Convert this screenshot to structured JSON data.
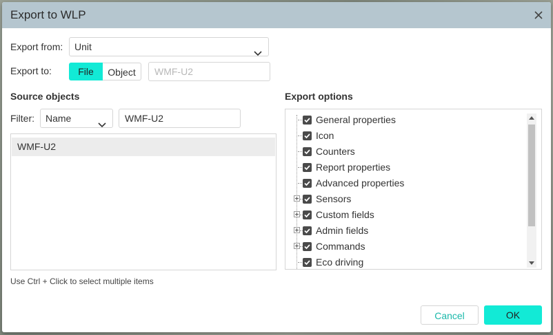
{
  "dialog": {
    "title": "Export to WLP"
  },
  "export_from": {
    "label": "Export from:",
    "value": "Unit"
  },
  "export_to": {
    "label": "Export to:",
    "options": [
      "File",
      "Object"
    ],
    "selected": "File",
    "object_placeholder": "WMF-U2"
  },
  "source_objects": {
    "title": "Source objects",
    "filter_label": "Filter:",
    "filter_field": "Name",
    "filter_value": "WMF-U2",
    "items": [
      "WMF-U2"
    ],
    "hint": "Use Ctrl + Click to select multiple items"
  },
  "export_options": {
    "title": "Export options",
    "items": [
      {
        "label": "General properties",
        "checked": true,
        "expandable": false
      },
      {
        "label": "Icon",
        "checked": true,
        "expandable": false
      },
      {
        "label": "Counters",
        "checked": true,
        "expandable": false
      },
      {
        "label": "Report properties",
        "checked": true,
        "expandable": false
      },
      {
        "label": "Advanced properties",
        "checked": true,
        "expandable": false
      },
      {
        "label": "Sensors",
        "checked": true,
        "expandable": true
      },
      {
        "label": "Custom fields",
        "checked": true,
        "expandable": true
      },
      {
        "label": "Admin fields",
        "checked": true,
        "expandable": true
      },
      {
        "label": "Commands",
        "checked": true,
        "expandable": true
      },
      {
        "label": "Eco driving",
        "checked": true,
        "expandable": false
      }
    ]
  },
  "buttons": {
    "cancel": "Cancel",
    "ok": "OK"
  },
  "colors": {
    "accent": "#12ead6",
    "titlebar": "#b5c6cf"
  }
}
